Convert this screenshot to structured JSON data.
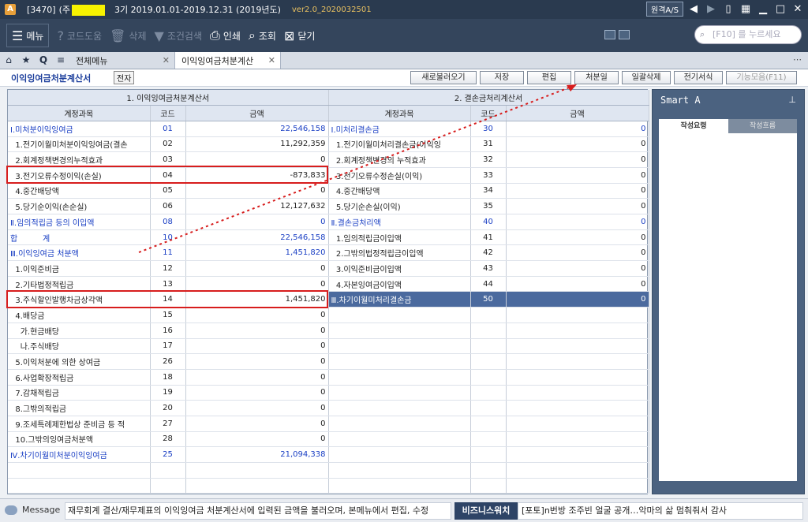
{
  "titlebar": {
    "company_code": "[3470]",
    "company_prefix": "(주",
    "period": "3기  2019.01.01-2019.12.31  (2019년도)",
    "version": "ver2.0_2020032501",
    "remote_label": "원격A/S"
  },
  "toolbar": {
    "menu": "메뉴",
    "code_help": "코드도움",
    "delete": "삭제",
    "filter": "조건검색",
    "print": "인쇄",
    "lookup": "조회",
    "close": "닫기",
    "search_placeholder": "[F10] 를 누르세요"
  },
  "tabs": [
    {
      "label": "전체메뉴"
    },
    {
      "label": "이익잉여금처분계산"
    }
  ],
  "subheader": {
    "title": "이익잉여금처분계산서",
    "badge": "전자",
    "buttons": [
      "새로불러오기",
      "저장",
      "편집",
      "처분일",
      "일괄삭제",
      "전기서식",
      "기능모음(F11)"
    ]
  },
  "grid": {
    "left_title": "1. 이익잉여금처분계산서",
    "right_title": "2. 결손금처리계산서",
    "col_account": "계정과목",
    "col_code": "코드",
    "col_amount": "금액",
    "rows": [
      {
        "l_name": "Ⅰ.미처분이익잉여금",
        "l_code": "01",
        "l_amt": "22,546,158",
        "l_blue": true,
        "r_name": "Ⅰ.미처리결손금",
        "r_code": "30",
        "r_amt": "0",
        "r_blue": true
      },
      {
        "l_name": "  1.전기이월미처분이익잉여금(결손",
        "l_code": "02",
        "l_amt": "11,292,359",
        "r_name": "  1.전기이월미처리결손금(이익잉",
        "r_code": "31",
        "r_amt": "0"
      },
      {
        "l_name": "  2.회계정책변경의누적효과",
        "l_code": "03",
        "l_amt": "0",
        "r_name": "  2.회계정책변경의 누적효과",
        "r_code": "32",
        "r_amt": "0"
      },
      {
        "l_name": "  3.전기오류수정이익(손실)",
        "l_code": "04",
        "l_amt": "-873,833",
        "r_name": "  3.전기오류수정손실(이익)",
        "r_code": "33",
        "r_amt": "0"
      },
      {
        "l_name": "  4.중간배당액",
        "l_code": "05",
        "l_amt": "0",
        "r_name": "  4.중간배당액",
        "r_code": "34",
        "r_amt": "0"
      },
      {
        "l_name": "  5.당기순이익(손순실)",
        "l_code": "06",
        "l_amt": "12,127,632",
        "r_name": "  5.당기순손실(이익)",
        "r_code": "35",
        "r_amt": "0"
      },
      {
        "l_name": "Ⅱ.임의적립금 등의 이입액",
        "l_code": "08",
        "l_amt": "0",
        "l_blue": true,
        "r_name": "Ⅱ.결손금처리액",
        "r_code": "40",
        "r_amt": "0",
        "r_blue": true
      },
      {
        "l_name": "합          계",
        "l_code": "10",
        "l_amt": "22,546,158",
        "l_blue": true,
        "r_name": "  1.임의적립금이입액",
        "r_code": "41",
        "r_amt": "0"
      },
      {
        "l_name": "Ⅲ.이익잉여금 처분액",
        "l_code": "11",
        "l_amt": "1,451,820",
        "l_blue": true,
        "r_name": "  2.그밖의법정적립금이입액",
        "r_code": "42",
        "r_amt": "0"
      },
      {
        "l_name": "  1.이익준비금",
        "l_code": "12",
        "l_amt": "0",
        "r_name": "  3.이익준비금이입액",
        "r_code": "43",
        "r_amt": "0"
      },
      {
        "l_name": "  2.기타법정적립금",
        "l_code": "13",
        "l_amt": "0",
        "r_name": "  4.자본잉여금이입액",
        "r_code": "44",
        "r_amt": "0"
      },
      {
        "l_name": "  3.주식할인발행차금상각액",
        "l_code": "14",
        "l_amt": "1,451,820",
        "r_name": "Ⅲ.차기이월미처리결손금",
        "r_code": "50",
        "r_amt": "0",
        "r_sel": true
      },
      {
        "l_name": "  4.배당금",
        "l_code": "15",
        "l_amt": "0",
        "r_name": "",
        "r_code": "",
        "r_amt": ""
      },
      {
        "l_name": "    가.현금배당",
        "l_code": "16",
        "l_amt": "0",
        "r_name": "",
        "r_code": "",
        "r_amt": ""
      },
      {
        "l_name": "    나.주식배당",
        "l_code": "17",
        "l_amt": "0",
        "r_name": "",
        "r_code": "",
        "r_amt": ""
      },
      {
        "l_name": "  5.이익처분에 의한 상여금",
        "l_code": "26",
        "l_amt": "0",
        "r_name": "",
        "r_code": "",
        "r_amt": ""
      },
      {
        "l_name": "  6.사업확장적립금",
        "l_code": "18",
        "l_amt": "0",
        "r_name": "",
        "r_code": "",
        "r_amt": ""
      },
      {
        "l_name": "  7.감채적립금",
        "l_code": "19",
        "l_amt": "0",
        "r_name": "",
        "r_code": "",
        "r_amt": ""
      },
      {
        "l_name": "  8.그밖의적립금",
        "l_code": "20",
        "l_amt": "0",
        "r_name": "",
        "r_code": "",
        "r_amt": ""
      },
      {
        "l_name": "  9.조세특례제한법상 준비금 등 적",
        "l_code": "27",
        "l_amt": "0",
        "r_name": "",
        "r_code": "",
        "r_amt": ""
      },
      {
        "l_name": "  10.그밖의잉여금처분액",
        "l_code": "28",
        "l_amt": "0",
        "r_name": "",
        "r_code": "",
        "r_amt": ""
      },
      {
        "l_name": "Ⅳ.차기이월미처분이익잉여금",
        "l_code": "25",
        "l_amt": "21,094,338",
        "l_blue": true,
        "r_name": "",
        "r_code": "",
        "r_amt": ""
      },
      {
        "l_name": "",
        "l_code": "",
        "l_amt": "",
        "r_name": "",
        "r_code": "",
        "r_amt": ""
      },
      {
        "l_name": "",
        "l_code": "",
        "l_amt": "",
        "r_name": "",
        "r_code": "",
        "r_amt": ""
      }
    ]
  },
  "smart_panel": {
    "title": "Smart A",
    "tab_active": "작성요령",
    "tab_inactive": "작성흐름"
  },
  "bottom": {
    "message_label": "Message",
    "message_text": "재무회계 결산/재무제표의 이익잉여금 처분계산서에 입력된 금액을 불러오며, 본메뉴에서 편집, 수정",
    "biz_label": "비즈니스워치",
    "news": "[포토]n번방 조주빈 얼굴 공개…악마의 삶 멈춰줘서 감사"
  },
  "colors": {
    "accent_blue": "#1a3fc4",
    "highlight_red": "#d71d1d",
    "selected_row": "#4b6a9e"
  }
}
